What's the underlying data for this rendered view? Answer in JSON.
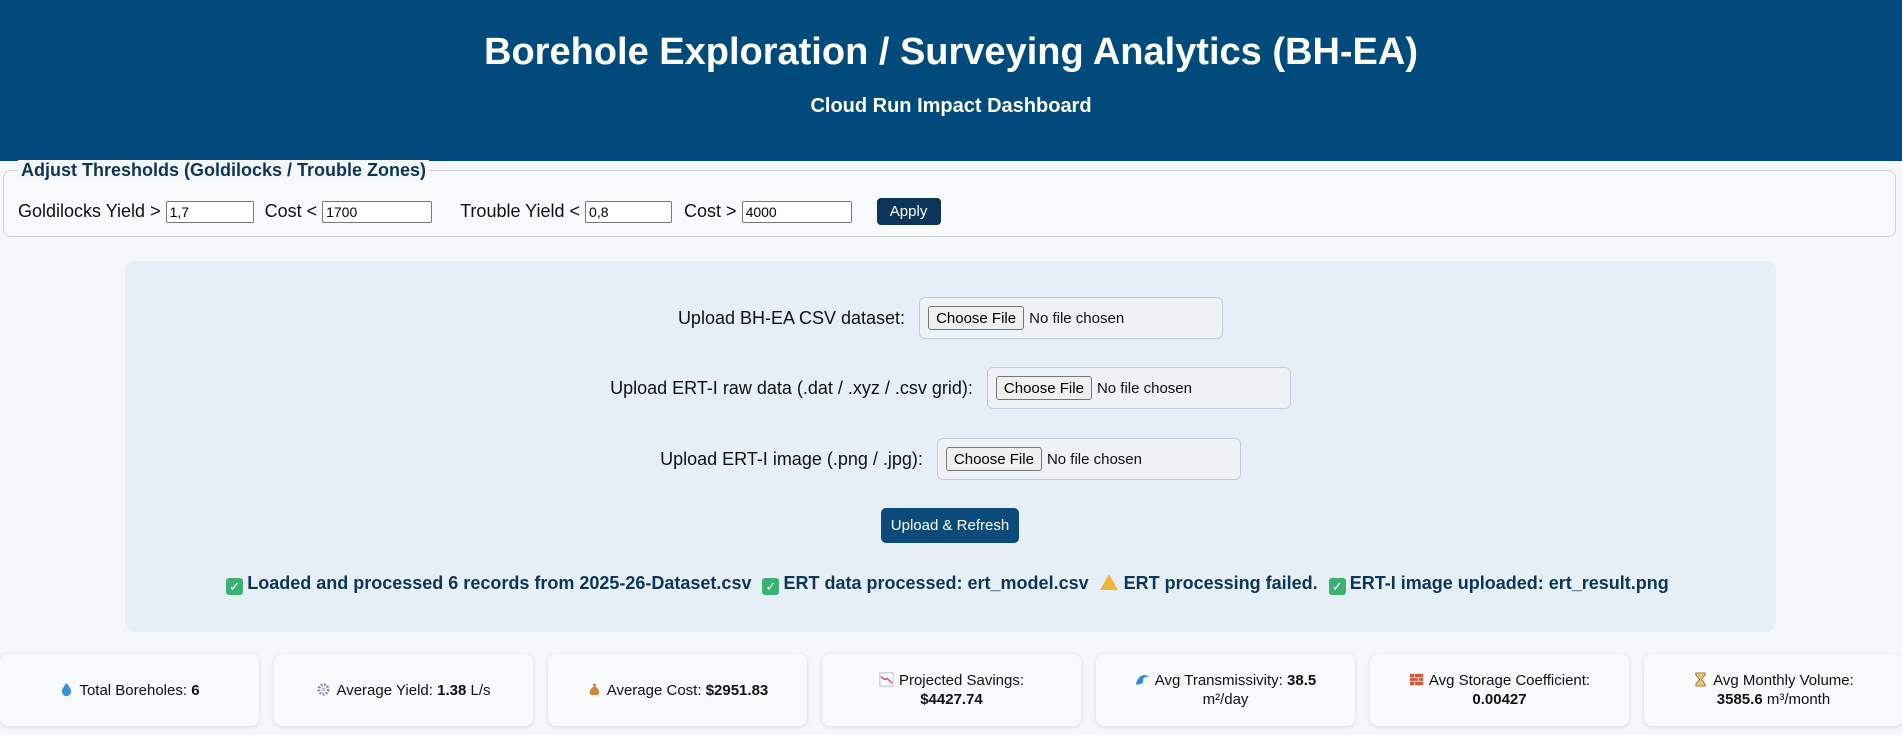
{
  "header": {
    "title": "Borehole Exploration / Surveying Analytics (BH-EA)",
    "subtitle": "Cloud Run Impact Dashboard"
  },
  "thresholds": {
    "legend": "Adjust Thresholds (Goldilocks / Trouble Zones)",
    "goldilocks_yield_label": "Goldilocks Yield >",
    "goldilocks_yield_value": "1,7",
    "goldilocks_cost_label": "Cost <",
    "goldilocks_cost_value": "1700",
    "trouble_yield_label": "Trouble Yield <",
    "trouble_yield_value": "0,8",
    "trouble_cost_label": "Cost >",
    "trouble_cost_value": "4000",
    "apply_label": "Apply"
  },
  "uploads": {
    "csv_label": "Upload BH-EA CSV dataset:",
    "ert_raw_label": "Upload ERT-I raw data (.dat / .xyz / .csv grid):",
    "ert_image_label": "Upload ERT-I image (.png / .jpg):",
    "choose_file": "Choose File",
    "no_file": "No file chosen",
    "refresh_label": "Upload & Refresh"
  },
  "status": {
    "loaded": "Loaded and processed 6 records from 2025-26-Dataset.csv",
    "ert_processed": "ERT data processed: ert_model.csv",
    "ert_failed": "ERT processing failed.",
    "ert_image": "ERT-I image uploaded: ert_result.png"
  },
  "kpis": [
    {
      "icon": "droplet-icon",
      "label": "Total Boreholes:",
      "value": "6",
      "unit": ""
    },
    {
      "icon": "gear-icon",
      "label": "Average Yield:",
      "value": "1.38",
      "unit": "L/s"
    },
    {
      "icon": "money-bag-icon",
      "label": "Average Cost:",
      "value": "$2951.83",
      "unit": ""
    },
    {
      "icon": "chart-down-icon",
      "label": "Projected Savings:",
      "value": "$4427.74",
      "unit": ""
    },
    {
      "icon": "wave-icon",
      "label": "Avg Transmissivity:",
      "value": "38.5",
      "unit": "m²/day"
    },
    {
      "icon": "brick-icon",
      "label": "Avg Storage Coefficient:",
      "value": "0.00427",
      "unit": ""
    },
    {
      "icon": "hourglass-icon",
      "label": "Avg Monthly Volume:",
      "value": "3585.6",
      "unit": "m³/month"
    }
  ],
  "colors": {
    "header_bg": "#004a7c",
    "accent_dark": "#0d3559",
    "success": "#3bb273",
    "warning": "#f1b43a"
  }
}
